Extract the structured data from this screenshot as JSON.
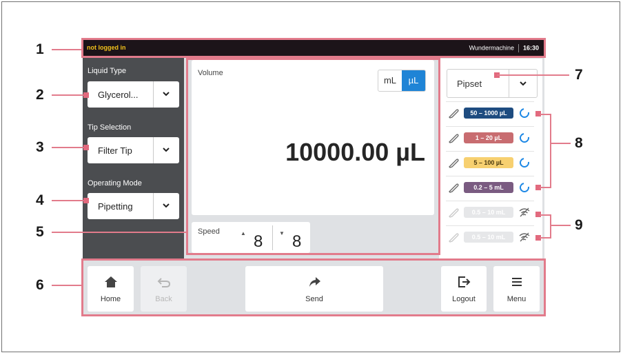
{
  "callouts": [
    "1",
    "2",
    "3",
    "4",
    "5",
    "6",
    "7",
    "8",
    "9"
  ],
  "status_bar": {
    "login_state": "not logged in",
    "device_name": "Wundermachine",
    "time": "16:30"
  },
  "left_panel": {
    "liquid_type": {
      "label": "Liquid Type",
      "value": "Glycerol..."
    },
    "tip_selection": {
      "label": "Tip Selection",
      "value": "Filter Tip"
    },
    "operating_mode": {
      "label": "Operating Mode",
      "value": "Pipetting"
    }
  },
  "volume": {
    "label": "Volume",
    "value": "10000.00 µL",
    "unit_ml": "mL",
    "unit_ul": "µL",
    "selected_unit": "µL"
  },
  "speed": {
    "label": "Speed",
    "up_arrow": "▲",
    "down_arrow": "▼",
    "aspirate": "8",
    "dispense": "8"
  },
  "right_panel": {
    "pipset": "Pipset",
    "pipettes": [
      {
        "range": "50 – 1000 µL",
        "badge_color": "#1e4c80",
        "text_color": "#ffffff",
        "state": "connected"
      },
      {
        "range": "1 – 20 µL",
        "badge_color": "#c86c70",
        "text_color": "#ffffff",
        "state": "connected"
      },
      {
        "range": "5 – 100 µL",
        "badge_color": "#f7d070",
        "text_color": "#4a3a10",
        "state": "connected"
      },
      {
        "range": "0.2 – 5 mL",
        "badge_color": "#7a5b81",
        "text_color": "#ffffff",
        "state": "connected"
      },
      {
        "range": "0.5 – 10 mL",
        "badge_color": "#e6e7e9",
        "text_color": "#ffffff",
        "state": "disconnected"
      },
      {
        "range": "0.5 – 10 mL",
        "badge_color": "#e6e7e9",
        "text_color": "#ffffff",
        "state": "disconnected"
      }
    ]
  },
  "bottom_bar": {
    "home": "Home",
    "back": "Back",
    "send": "Send",
    "logout": "Logout",
    "menu": "Menu"
  },
  "colors": {
    "accent": "#1f84d6",
    "highlight": "#e27b8b",
    "status_bar": "#1c1419",
    "login_text": "#f3c21b",
    "left_panel": "#4b4d50"
  }
}
